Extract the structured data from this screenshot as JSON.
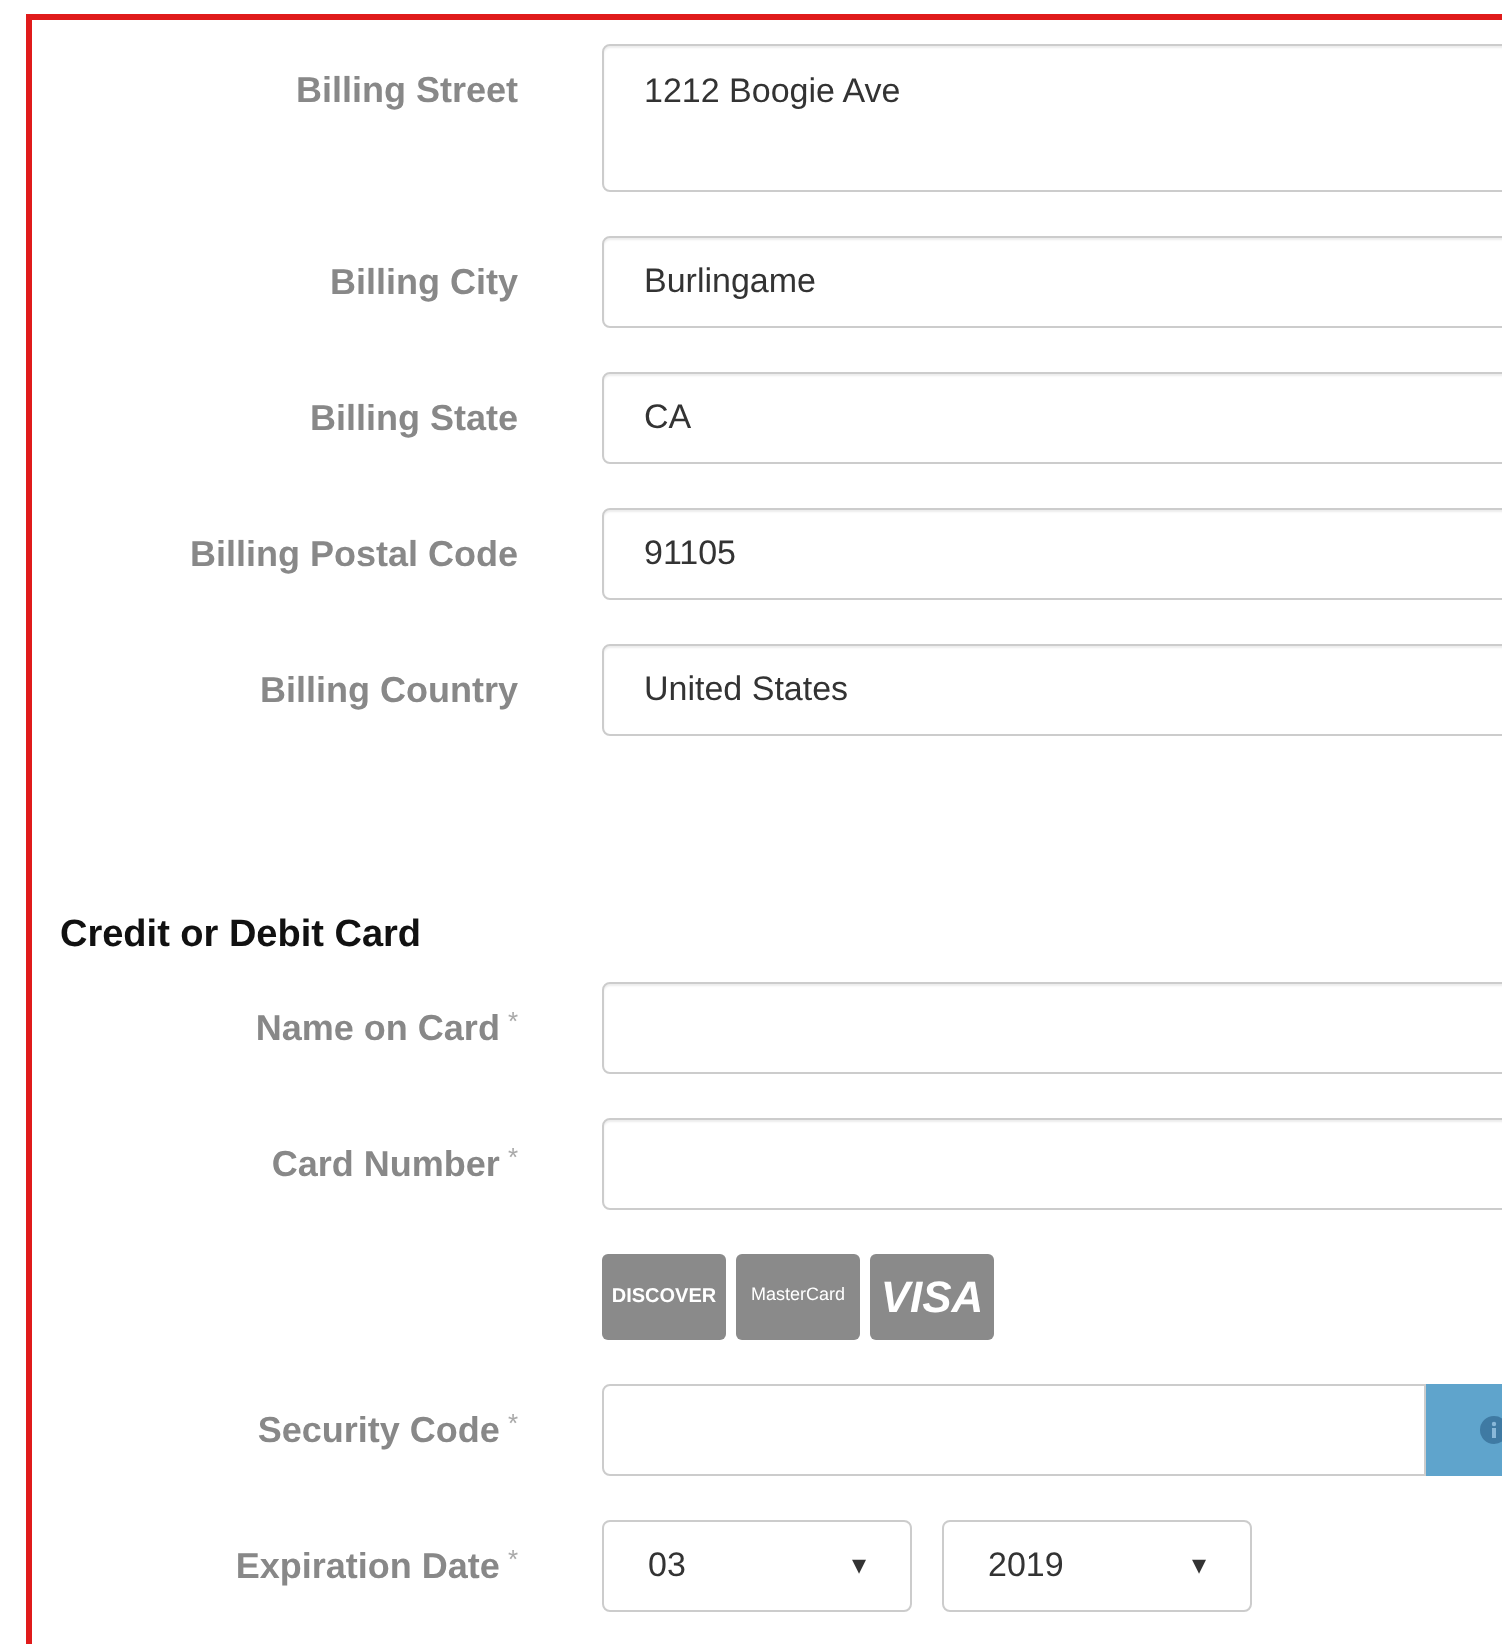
{
  "billing_fields": [
    {
      "label": "Billing Street",
      "kind": "textarea",
      "value": "1212 Boogie Ave"
    },
    {
      "label": "Billing City",
      "kind": "text",
      "value": "Burlingame"
    },
    {
      "label": "Billing State",
      "kind": "text",
      "value": "CA"
    },
    {
      "label": "Billing Postal Code",
      "kind": "text",
      "value": "91105"
    },
    {
      "label": "Billing Country",
      "kind": "text",
      "value": "United States"
    }
  ],
  "card_section": {
    "heading": "Credit or Debit Card",
    "fields": [
      {
        "label": "Name on Card",
        "required_mark": "*",
        "kind": "text"
      },
      {
        "label": "Card Number",
        "required_mark": "*",
        "kind": "text"
      },
      {
        "kind": "card_logos",
        "logos": [
          "DISCOVER",
          "MasterCard",
          "VISA"
        ]
      },
      {
        "label": "Security Code",
        "required_mark": "*",
        "kind": "info_input"
      },
      {
        "label": "Expiration Date",
        "required_mark": "*",
        "kind": "selects",
        "selects": [
          {
            "value": "03",
            "arrow": "▾"
          },
          {
            "value": "2019",
            "arrow": "▾"
          }
        ]
      }
    ]
  }
}
